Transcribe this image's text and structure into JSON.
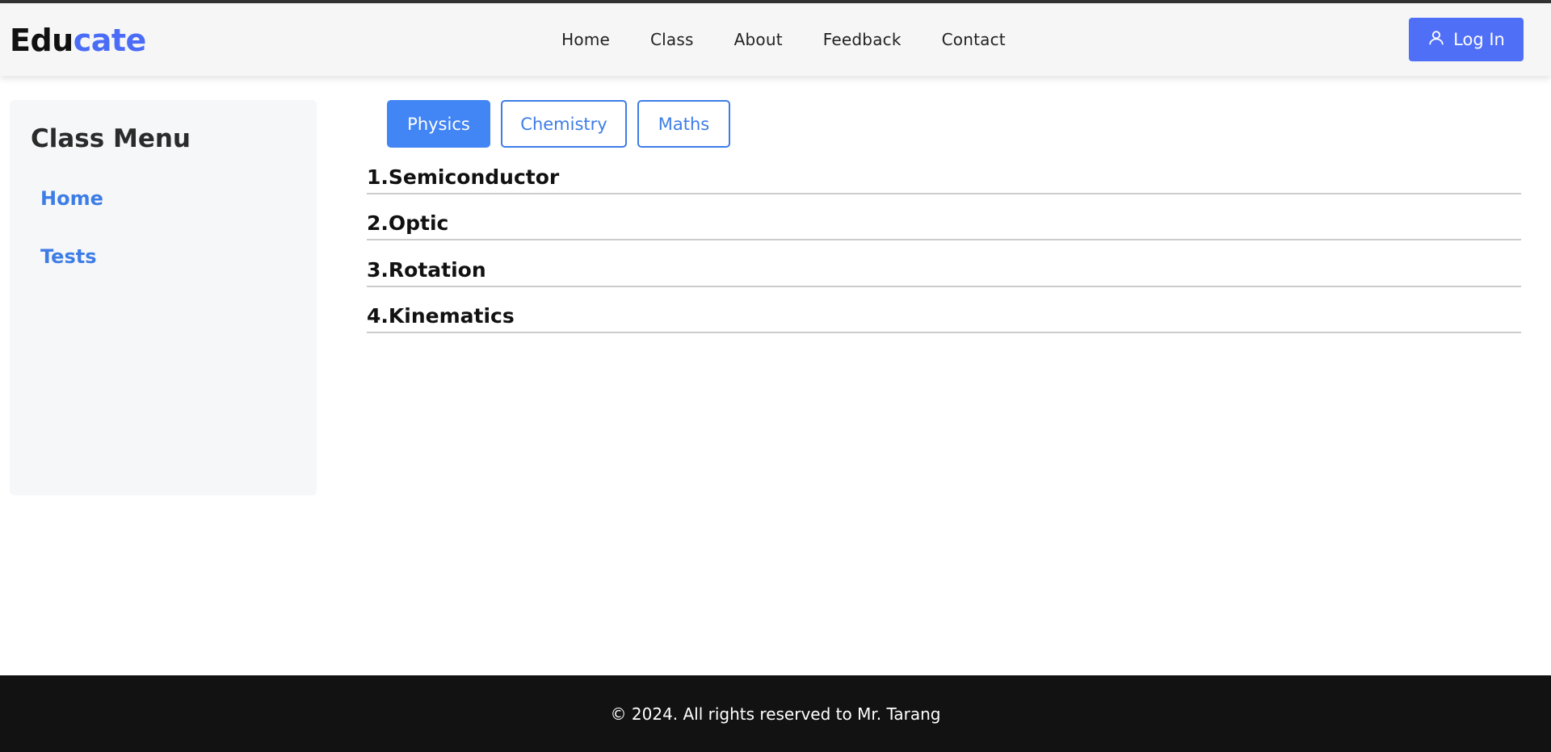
{
  "brand": {
    "logo_part1": "Edu",
    "logo_part2": "cate"
  },
  "nav": {
    "items": [
      "Home",
      "Class",
      "About",
      "Feedback",
      "Contact"
    ]
  },
  "login": {
    "label": "Log In",
    "icon": "user-icon"
  },
  "sidebar": {
    "title": "Class Menu",
    "items": [
      "Home",
      "Tests"
    ]
  },
  "tabs": {
    "items": [
      "Physics",
      "Chemistry",
      "Maths"
    ],
    "active": "Physics"
  },
  "topics": [
    "1.Semiconductor",
    "2.Optic",
    "3.Rotation",
    "4.Kinematics"
  ],
  "footer": {
    "text": "© 2024. All rights reserved to Mr. Tarang"
  },
  "colors": {
    "accent": "#4f6ff7",
    "tab_active": "#4285f4",
    "link": "#3d7de6",
    "footer_bg": "#121212"
  }
}
